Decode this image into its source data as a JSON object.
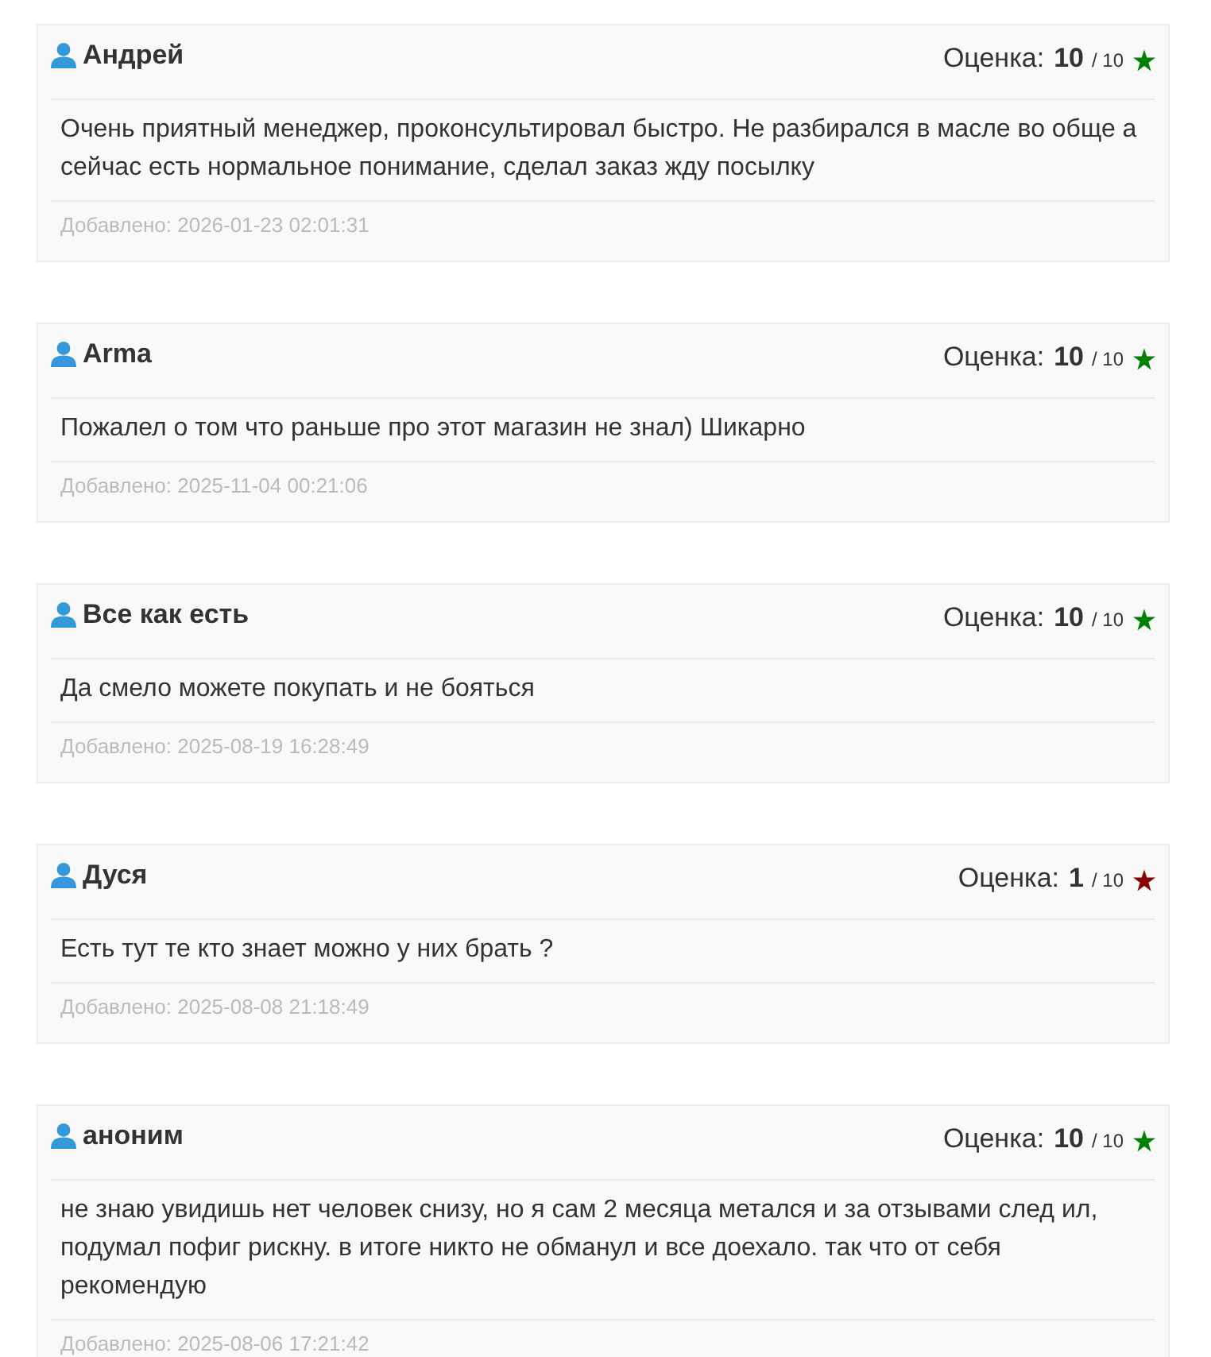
{
  "reviews": [
    {
      "author": "Андрей",
      "rating": {
        "label": "Оценка:",
        "score": "10",
        "max": "/ 10",
        "color": "#008000"
      },
      "text": "Очень приятный менеджер, проконсультировал быстро. Не разбирался в масле во обще а сейчас есть нормальное понимание, сделал заказ жду посылку",
      "date": "Добавлено: 2026-01-23 02:01:31"
    },
    {
      "author": "Arma",
      "rating": {
        "label": "Оценка:",
        "score": "10",
        "max": "/ 10",
        "color": "#008000"
      },
      "text": "Пожалел о том что раньше про этот магазин не знал) Шикарно",
      "date": "Добавлено: 2025-11-04 00:21:06"
    },
    {
      "author": "Все как есть",
      "rating": {
        "label": "Оценка:",
        "score": "10",
        "max": "/ 10",
        "color": "#008000"
      },
      "text": "Да смело можете покупать и не бояться",
      "date": "Добавлено: 2025-08-19 16:28:49"
    },
    {
      "author": "Дуся",
      "rating": {
        "label": "Оценка:",
        "score": "1",
        "max": "/ 10",
        "color": "#8b0000"
      },
      "text": "Есть тут те кто знает можно у них брать ?",
      "date": "Добавлено: 2025-08-08 21:18:49"
    },
    {
      "author": "аноним",
      "rating": {
        "label": "Оценка:",
        "score": "10",
        "max": "/ 10",
        "color": "#008000"
      },
      "text": "не знаю увидишь нет человек снизу, но я сам 2 месяца метался и за отзывами след ил, подумал пофиг рискну. в итоге никто не обманул и все доехало. так что от себя рекомендую",
      "date": "Добавлено: 2025-08-06 17:21:42"
    }
  ]
}
